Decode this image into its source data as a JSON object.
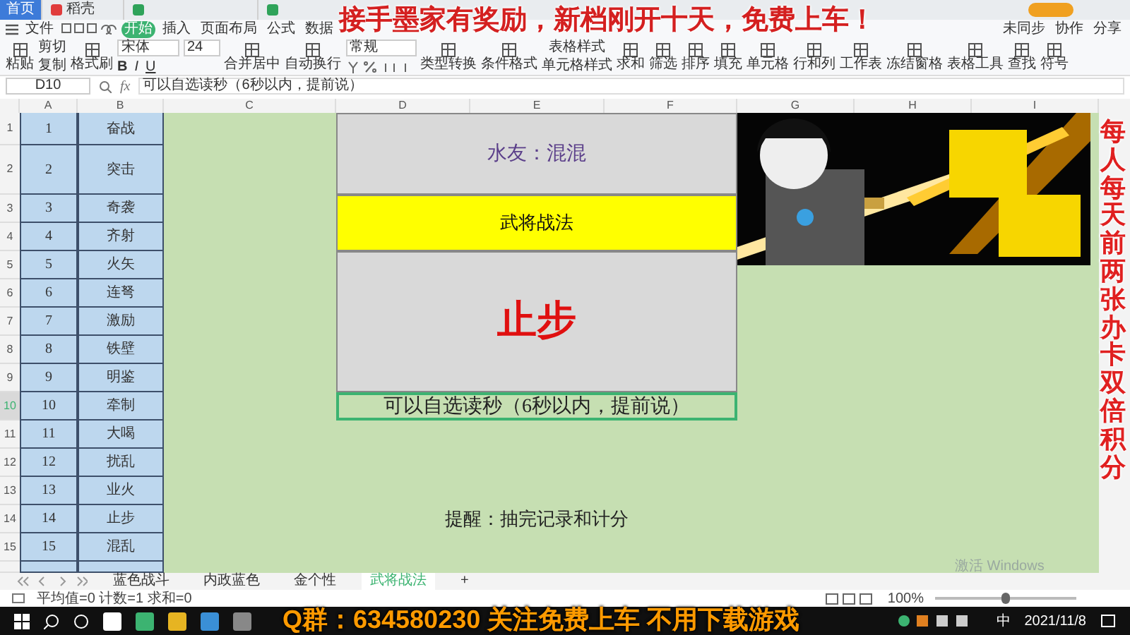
{
  "title_tabs": [
    {
      "label": "首页",
      "kind": "home"
    },
    {
      "label": "稻壳",
      "kind": "docer"
    },
    {
      "kind": "sheet"
    },
    {
      "kind": "sheet"
    }
  ],
  "menu": {
    "file": "文件",
    "tabs": [
      {
        "label": "开始",
        "selected": true
      },
      {
        "label": "插入",
        "selected": false
      },
      {
        "label": "页面布局",
        "selected": false
      },
      {
        "label": "公式",
        "selected": false
      },
      {
        "label": "数据",
        "selected": false
      }
    ],
    "right": [
      "未同步",
      "协作",
      "分享"
    ]
  },
  "toolbar": [
    {
      "kind": "big",
      "label": "粘贴"
    },
    {
      "kind": "pair",
      "labels": [
        "剪切",
        "复制"
      ]
    },
    {
      "kind": "big",
      "label": "格式刷"
    },
    {
      "kind": "font",
      "font": "宋体",
      "size": "24",
      "styles": [
        "B",
        "I",
        "U"
      ]
    },
    {
      "kind": "big",
      "label": "合并居中"
    },
    {
      "kind": "big",
      "label": "自动换行"
    },
    {
      "kind": "number",
      "format": "常规"
    },
    {
      "kind": "big",
      "label": "类型转换"
    },
    {
      "kind": "big",
      "label": "条件格式"
    },
    {
      "kind": "pair",
      "labels": [
        "表格样式",
        "单元格样式"
      ]
    },
    {
      "kind": "big",
      "label": "求和"
    },
    {
      "kind": "big",
      "label": "筛选"
    },
    {
      "kind": "big",
      "label": "排序"
    },
    {
      "kind": "big",
      "label": "填充"
    },
    {
      "kind": "big",
      "label": "单元格"
    },
    {
      "kind": "big",
      "label": "行和列"
    },
    {
      "kind": "big",
      "label": "工作表"
    },
    {
      "kind": "big",
      "label": "冻结窗格"
    },
    {
      "kind": "big",
      "label": "表格工具"
    },
    {
      "kind": "big",
      "label": "查找"
    },
    {
      "kind": "big",
      "label": "符号"
    }
  ],
  "formula_bar": {
    "name_box": "D10",
    "fx": "fx",
    "formula": "可以自选读秒（6秒以内，提前说）"
  },
  "sheet": {
    "columns": [
      "A",
      "B",
      "C",
      "D",
      "E",
      "F",
      "G",
      "H",
      "I"
    ],
    "rows": [
      {
        "number": "1",
        "a": "1",
        "b": "奋战",
        "selected": false
      },
      {
        "number": "2",
        "a": "2",
        "b": "突击",
        "selected": false
      },
      {
        "number": "3",
        "a": "3",
        "b": "奇袭",
        "selected": false
      },
      {
        "number": "4",
        "a": "4",
        "b": "齐射",
        "selected": false
      },
      {
        "number": "5",
        "a": "5",
        "b": "火矢",
        "selected": false
      },
      {
        "number": "6",
        "a": "6",
        "b": "连弩",
        "selected": false
      },
      {
        "number": "7",
        "a": "7",
        "b": "激励",
        "selected": false
      },
      {
        "number": "8",
        "a": "8",
        "b": "铁壁",
        "selected": false
      },
      {
        "number": "9",
        "a": "9",
        "b": "明鉴",
        "selected": false
      },
      {
        "number": "10",
        "a": "10",
        "b": "牵制",
        "selected": true
      },
      {
        "number": "11",
        "a": "11",
        "b": "大喝",
        "selected": false
      },
      {
        "number": "12",
        "a": "12",
        "b": "扰乱",
        "selected": false
      },
      {
        "number": "13",
        "a": "13",
        "b": "业火",
        "selected": false
      },
      {
        "number": "14",
        "a": "14",
        "b": "止步",
        "selected": false
      },
      {
        "number": "15",
        "a": "15",
        "b": "混乱",
        "selected": false
      }
    ],
    "blocks": [
      {
        "kind": "viewer",
        "text": "水友：混混"
      },
      {
        "kind": "title",
        "text": "武将战法"
      },
      {
        "kind": "result",
        "text": "止步"
      },
      {
        "kind": "note",
        "text": "可以自选读秒（6秒以内，提前说）",
        "selected": true
      },
      {
        "kind": "reminder",
        "text": "提醒：抽完记录和计分"
      }
    ]
  },
  "sheet_tabs": {
    "tabs": [
      {
        "label": "蓝色战斗",
        "selected": false
      },
      {
        "label": "内政蓝色",
        "selected": false
      },
      {
        "label": "金个性",
        "selected": false
      },
      {
        "label": "武将战法",
        "selected": true
      }
    ],
    "add": "+"
  },
  "status_bar": {
    "summary": "平均值=0 计数=1 求和=0",
    "zoom": "100%",
    "zoom_slider": {
      "level": 0.5
    }
  },
  "activation": "激活 Windows",
  "taskbar": {
    "ime": "中",
    "date": "2021/11/8"
  },
  "overlays": {
    "top": "接手墨家有奖励，新档刚开十天，免费上车！",
    "side": "每人每天前两张办卡双倍积分",
    "bottom": "Q群：634580230 关注免费上车 不用下载游戏"
  }
}
